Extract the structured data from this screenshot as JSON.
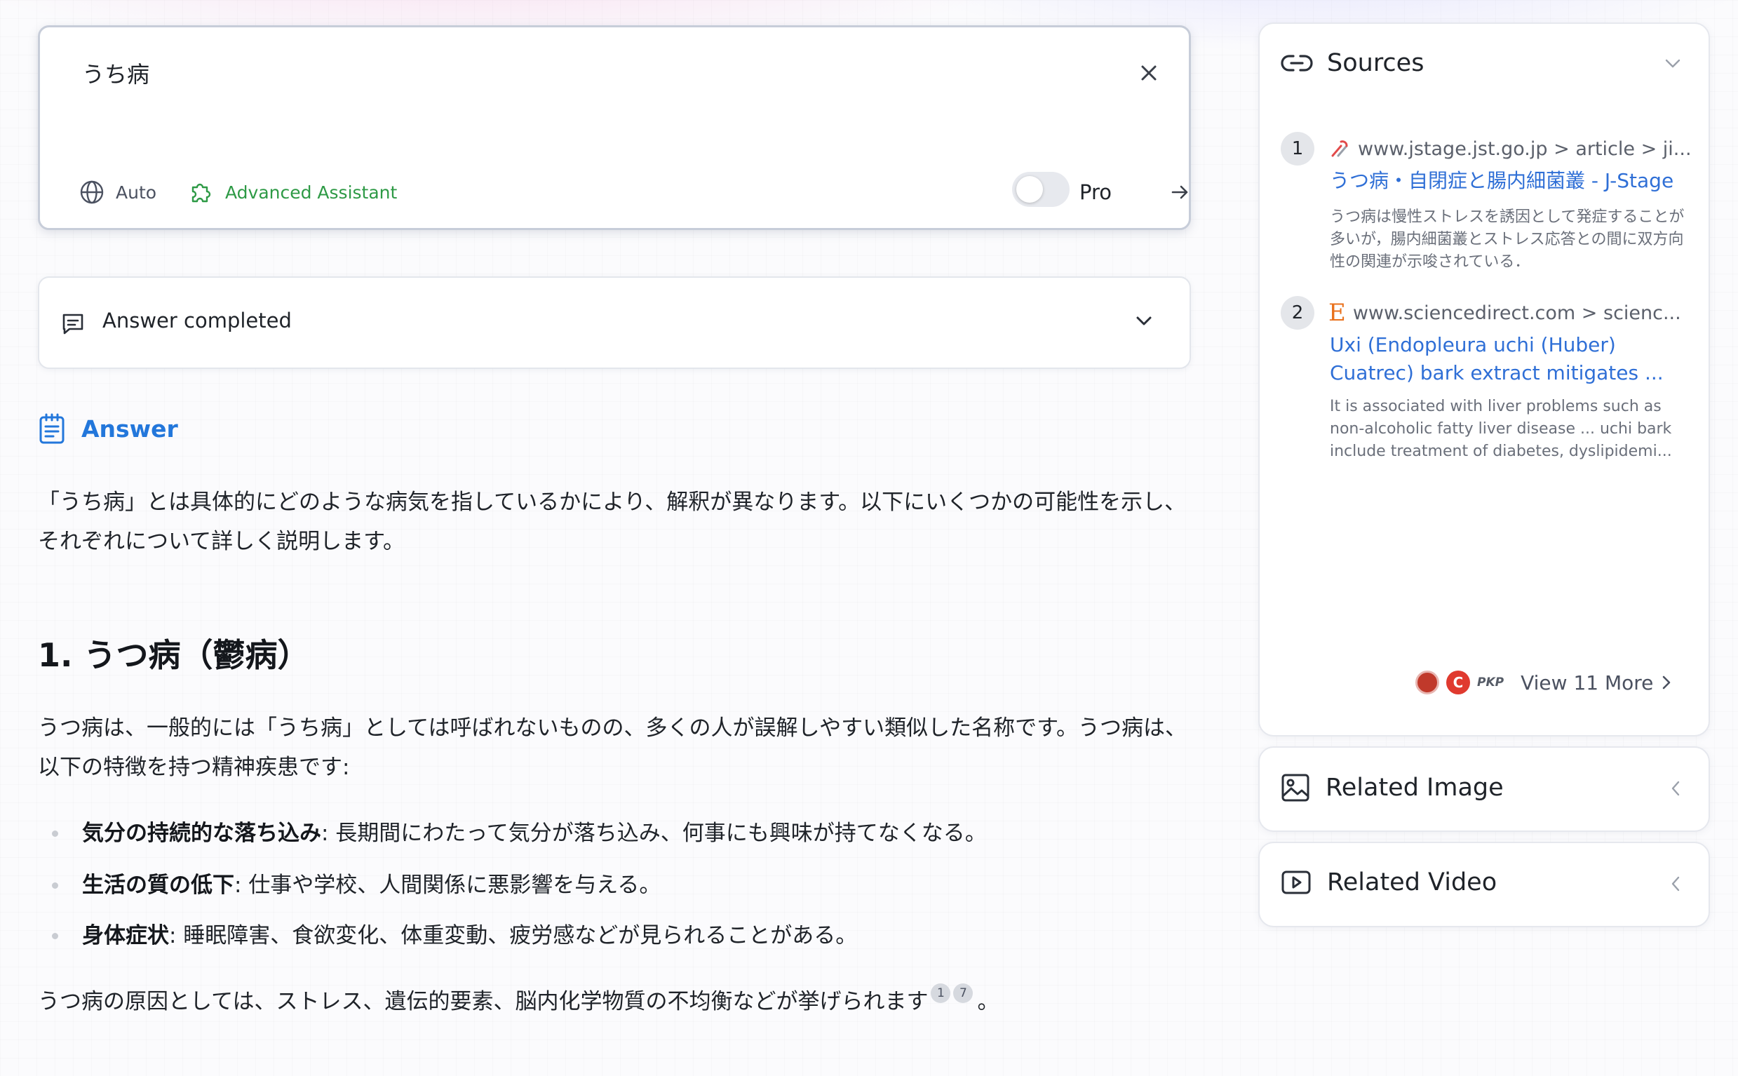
{
  "search": {
    "query": "うち病",
    "mode_auto_label": "Auto",
    "assistant_label": "Advanced Assistant",
    "pro_label": "Pro",
    "pro_enabled": false
  },
  "status": {
    "label": "Answer completed"
  },
  "answer": {
    "heading": "Answer",
    "intro": "「うち病」とは具体的にどのような病気を指しているかにより、解釈が異なります。以下にいくつかの可能性を示し、それぞれについて詳しく説明します。",
    "section_title": "1. うつ病（鬱病）",
    "section_para": "うつ病は、一般的には「うち病」としては呼ばれないものの、多くの人が誤解しやすい類似した名称です。うつ病は、以下の特徴を持つ精神疾患です:",
    "bullets": [
      {
        "term": "気分の持続的な落ち込み",
        "desc": ": 長期間にわたって気分が落ち込み、何事にも興味が持てなくなる。"
      },
      {
        "term": "生活の質の低下",
        "desc": ": 仕事や学校、人間関係に悪影響を与える。"
      },
      {
        "term": "身体症状",
        "desc": ": 睡眠障害、食欲変化、体重変動、疲労感などが見られることがある。"
      }
    ],
    "cause_text": "うつ病の原因としては、ストレス、遺伝的要素、脳内化学物質の不均衡などが挙げられます",
    "cause_citations": [
      "1",
      "7"
    ],
    "cause_end": "。"
  },
  "sources": {
    "heading": "Sources",
    "items": [
      {
        "num": "1",
        "domain": "www.jstage.jst.go.jp > article > ji...",
        "title": "うつ病・自閉症と腸内細菌叢 - J-Stage",
        "snippet": "うつ病は慢性ストレスを誘因として発症することが多いが，腸内細菌叢とストレス応答との間に双方向性の関連が示唆されている．"
      },
      {
        "num": "2",
        "domain": "www.sciencedirect.com > scienc...",
        "favicon_letter": "E",
        "title": "Uxi (Endopleura uchi (Huber) Cuatrec) bark extract mitigates ...",
        "snippet": "It is associated with liver problems such as non-alcoholic fatty liver disease ... uchi bark include treatment of diabetes, dyslipidemi..."
      }
    ],
    "more_favicons": [
      "seal-red",
      "C",
      "PKP"
    ],
    "more_label": "View 11 More"
  },
  "related_image": {
    "heading": "Related Image"
  },
  "related_video": {
    "heading": "Related Video"
  },
  "colors": {
    "accent_blue": "#2377db",
    "link_blue": "#2f6fd6",
    "assistant_green": "#2e9a46",
    "elsevier_orange": "#e9711c"
  }
}
